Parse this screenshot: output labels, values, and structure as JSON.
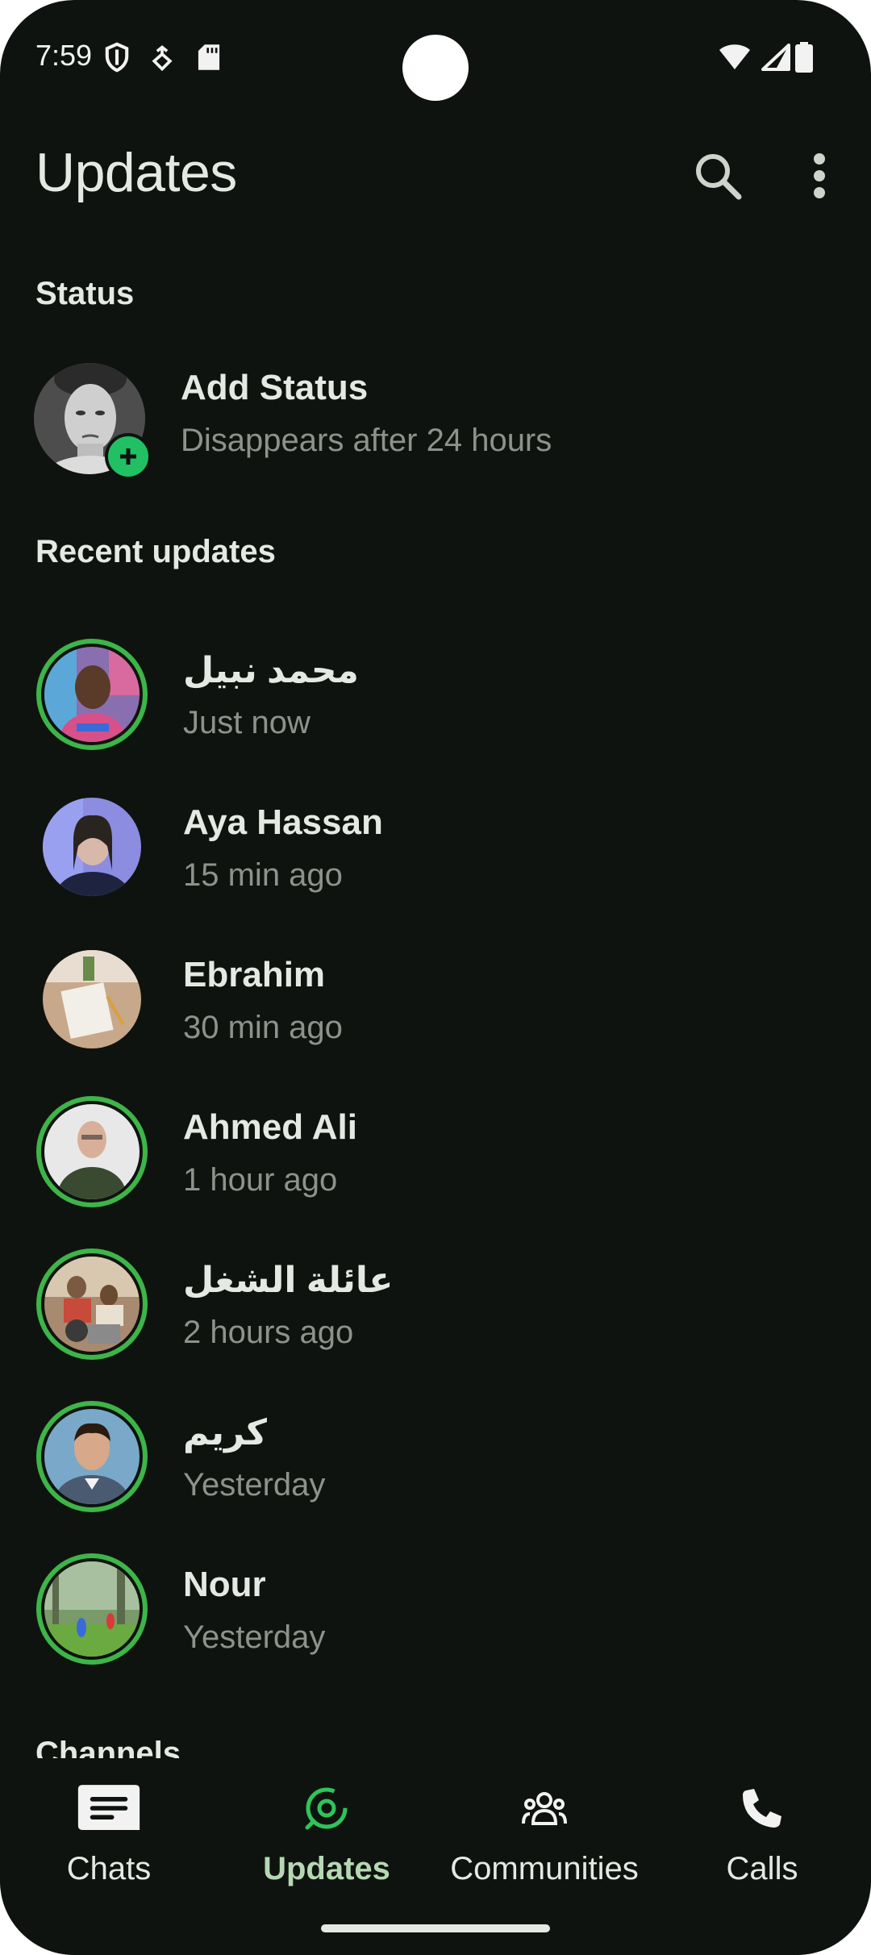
{
  "status_bar": {
    "time": "7:59"
  },
  "app_bar": {
    "title": "Updates"
  },
  "status_section": {
    "title": "Status",
    "add_status_label": "Add Status",
    "add_status_sub": "Disappears after 24 hours"
  },
  "recent_section": {
    "title": "Recent updates",
    "items": [
      {
        "name": "محمد نبيل",
        "time": "Just now"
      },
      {
        "name": "Aya Hassan",
        "time": "15 min ago"
      },
      {
        "name": "Ebrahim",
        "time": "30 min ago"
      },
      {
        "name": "Ahmed Ali",
        "time": "1 hour ago"
      },
      {
        "name": "عائلة الشغل",
        "time": "2 hours ago"
      },
      {
        "name": "كريم",
        "time": "Yesterday"
      },
      {
        "name": "Nour",
        "time": "Yesterday"
      }
    ]
  },
  "channels_section": {
    "title": "Channels"
  },
  "bottom_nav": {
    "items": [
      {
        "label": "Chats"
      },
      {
        "label": "Updates"
      },
      {
        "label": "Communities"
      },
      {
        "label": "Calls"
      }
    ],
    "active": "Updates"
  },
  "colors": {
    "background": "#0f130f",
    "accent_green": "#21c063",
    "status_ring": "#3db548",
    "active_nav": "#b5d8b3",
    "secondary_text": "#8d928b"
  }
}
